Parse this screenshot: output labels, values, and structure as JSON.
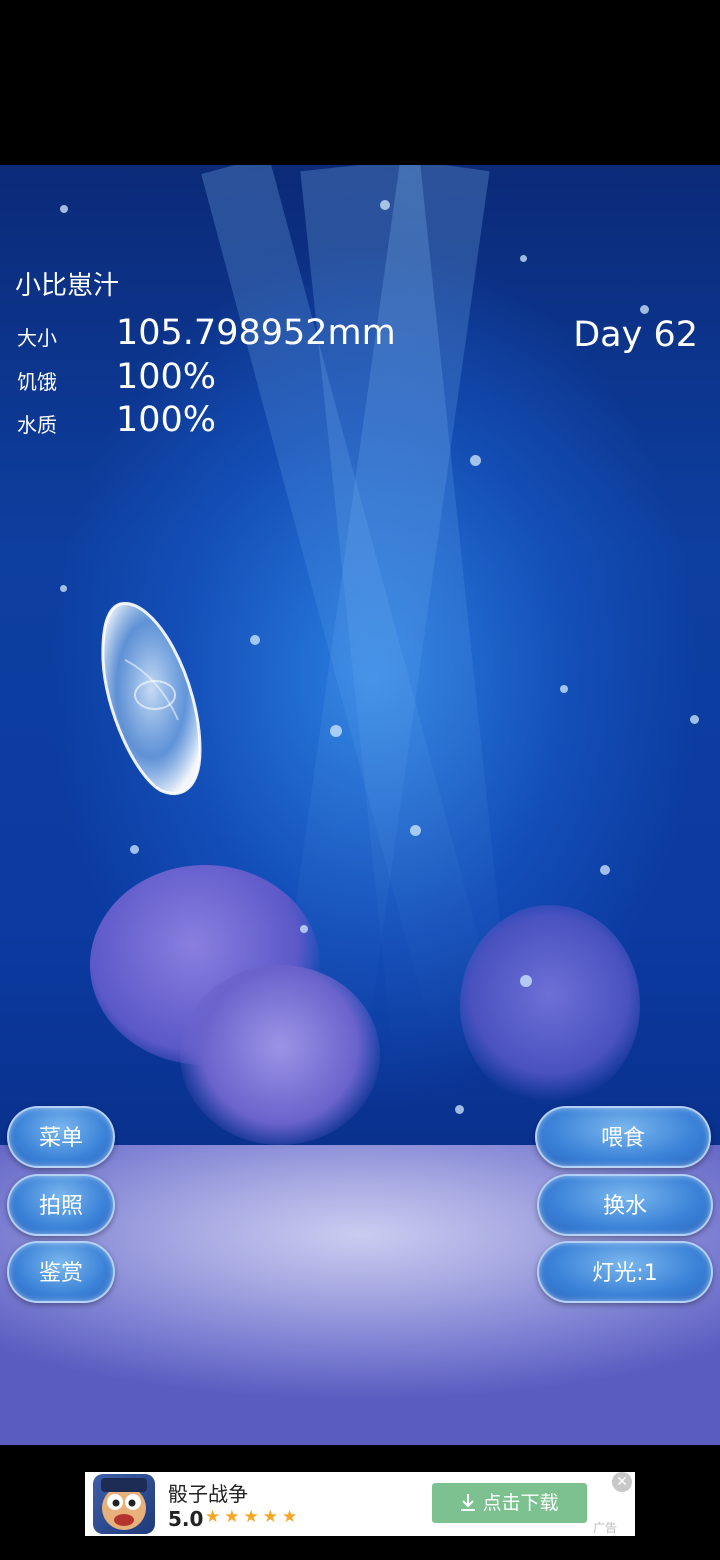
{
  "jellyfish_name": "小比崽汁",
  "stats": [
    {
      "label": "大小",
      "value": "105.798952mm"
    },
    {
      "label": "饥饿",
      "value": "100%"
    },
    {
      "label": "水质",
      "value": "100%"
    }
  ],
  "day": "Day 62",
  "left_buttons": [
    "菜单",
    "拍照",
    "鉴赏"
  ],
  "right_buttons": [
    "喂食",
    "换水",
    "灯光:1"
  ],
  "ad": {
    "title": "骰子战争",
    "rating": "5.0",
    "stars": "★★★★★",
    "download_label": "点击下载",
    "download_icon": "download-arrow-icon",
    "ad_mark": "广告",
    "close": "✕"
  },
  "colors": {
    "water_top": "#0b2a78",
    "water_mid": "#0d3fa0",
    "button_blue": "#3b82d8",
    "download_green": "#7cc18f",
    "star_color": "#f5a623"
  }
}
